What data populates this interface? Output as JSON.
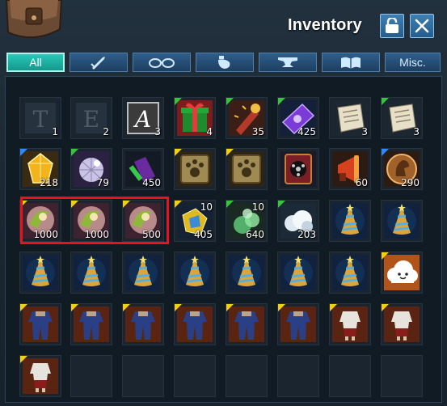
{
  "window": {
    "title": "Inventory",
    "colors": {
      "accent": "#29c9b9",
      "frame": "#1a2733",
      "highlight": "#e8131e"
    }
  },
  "header": {
    "lock_icon": "lock-icon",
    "close_icon": "close-icon",
    "bag_icon": "backpack-icon"
  },
  "tabs": [
    {
      "label": "All",
      "icon": "",
      "active": true
    },
    {
      "label": "",
      "icon": "sword-icon",
      "active": false
    },
    {
      "label": "",
      "icon": "glasses-icon",
      "active": false
    },
    {
      "label": "",
      "icon": "potion-icon",
      "active": false
    },
    {
      "label": "",
      "icon": "anvil-icon",
      "active": false
    },
    {
      "label": "",
      "icon": "book-icon",
      "active": false
    },
    {
      "label": "Misc.",
      "icon": "",
      "active": false
    }
  ],
  "slots": [
    {
      "icon": "rune-t-icon",
      "qty": "1",
      "rarity": "none"
    },
    {
      "icon": "rune-e-icon",
      "qty": "2",
      "rarity": "none"
    },
    {
      "icon": "rune-a-icon",
      "qty": "3",
      "rarity": "none"
    },
    {
      "icon": "gift-box-icon",
      "qty": "4",
      "rarity": "green"
    },
    {
      "icon": "firework-icon",
      "qty": "35",
      "rarity": "green"
    },
    {
      "icon": "ticket-icon",
      "qty": "425",
      "rarity": "green"
    },
    {
      "icon": "scroll-icon",
      "qty": "3",
      "rarity": "none"
    },
    {
      "icon": "scroll-icon",
      "qty": "3",
      "rarity": "green"
    },
    {
      "icon": "crystal-icon",
      "qty": "218",
      "rarity": "blue"
    },
    {
      "icon": "disco-ball-icon",
      "qty": "79",
      "rarity": "green"
    },
    {
      "icon": "bottle-icon",
      "qty": "450",
      "rarity": "none"
    },
    {
      "icon": "pet-book-icon",
      "qty": "",
      "rarity": "yellow"
    },
    {
      "icon": "pet-book-icon",
      "qty": "",
      "rarity": "yellow"
    },
    {
      "icon": "film-book-icon",
      "qty": "",
      "rarity": "none"
    },
    {
      "icon": "megaphone-icon",
      "qty": "60",
      "rarity": "none"
    },
    {
      "icon": "horse-token-icon",
      "qty": "290",
      "rarity": "blue"
    },
    {
      "icon": "swirl-orb-icon",
      "qty": "1000",
      "rarity": "yellow"
    },
    {
      "icon": "swirl-orb-icon",
      "qty": "1000",
      "rarity": "yellow"
    },
    {
      "icon": "swirl-orb-icon",
      "qty": "500",
      "rarity": "yellow"
    },
    {
      "icon": "emblem-icon",
      "qty": "405",
      "top": "10",
      "rarity": "yellow"
    },
    {
      "icon": "green-smoke-icon",
      "qty": "640",
      "top": "10",
      "rarity": "green"
    },
    {
      "icon": "white-cloud-icon",
      "qty": "203",
      "rarity": "green"
    },
    {
      "icon": "party-hat-icon",
      "qty": "",
      "rarity": "none"
    },
    {
      "icon": "party-hat-icon",
      "qty": "",
      "rarity": "none"
    },
    {
      "icon": "party-hat-icon",
      "qty": "",
      "rarity": "none"
    },
    {
      "icon": "party-hat-icon",
      "qty": "",
      "rarity": "none"
    },
    {
      "icon": "party-hat-icon",
      "qty": "",
      "rarity": "none"
    },
    {
      "icon": "party-hat-icon",
      "qty": "",
      "rarity": "none"
    },
    {
      "icon": "party-hat-icon",
      "qty": "",
      "rarity": "none"
    },
    {
      "icon": "party-hat-icon",
      "qty": "",
      "rarity": "none"
    },
    {
      "icon": "party-hat-icon",
      "qty": "",
      "rarity": "none"
    },
    {
      "icon": "cloud-face-icon",
      "qty": "",
      "rarity": "yellow"
    },
    {
      "icon": "blue-suit-icon",
      "qty": "",
      "rarity": "yellow"
    },
    {
      "icon": "blue-suit-icon",
      "qty": "",
      "rarity": "yellow"
    },
    {
      "icon": "blue-suit-icon",
      "qty": "",
      "rarity": "yellow"
    },
    {
      "icon": "blue-suit-icon",
      "qty": "",
      "rarity": "yellow"
    },
    {
      "icon": "blue-suit-icon",
      "qty": "",
      "rarity": "yellow"
    },
    {
      "icon": "blue-suit-icon",
      "qty": "",
      "rarity": "yellow"
    },
    {
      "icon": "white-outfit-icon",
      "qty": "",
      "rarity": "yellow"
    },
    {
      "icon": "white-outfit-icon",
      "qty": "",
      "rarity": "yellow"
    },
    {
      "icon": "white-outfit-icon",
      "qty": "",
      "rarity": "yellow"
    },
    {
      "icon": "",
      "qty": "",
      "rarity": "none"
    },
    {
      "icon": "",
      "qty": "",
      "rarity": "none"
    },
    {
      "icon": "",
      "qty": "",
      "rarity": "none"
    },
    {
      "icon": "",
      "qty": "",
      "rarity": "none"
    },
    {
      "icon": "",
      "qty": "",
      "rarity": "none"
    },
    {
      "icon": "",
      "qty": "",
      "rarity": "none"
    },
    {
      "icon": "",
      "qty": "",
      "rarity": "none"
    }
  ]
}
